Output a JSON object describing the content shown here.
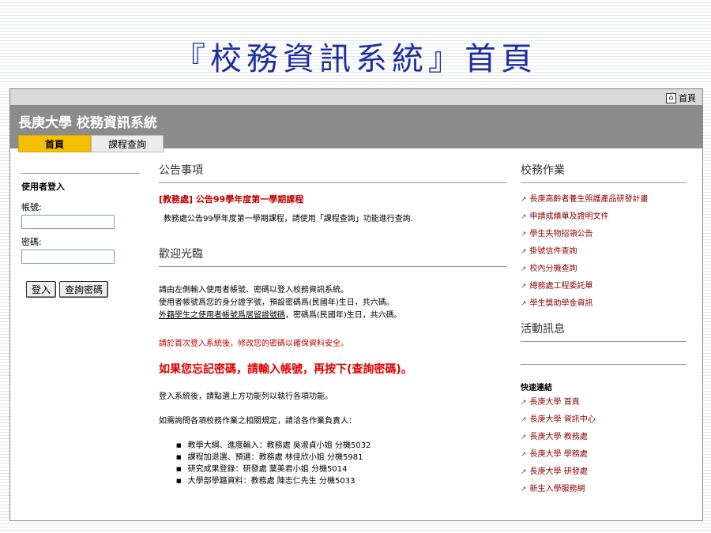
{
  "slide": {
    "title": "『校務資訊系統』首頁"
  },
  "topbar": {
    "home_label": "首頁",
    "home_icon": "home-icon"
  },
  "header": {
    "site_title": "長庚大學 校務資訊系統"
  },
  "tabs": [
    {
      "label": "首頁",
      "active": true
    },
    {
      "label": "課程查詢",
      "active": false
    }
  ],
  "login": {
    "title": "使用者登入",
    "username_label": "帳號:",
    "username_value": "",
    "password_label": "密碼:",
    "password_value": "",
    "login_button": "登入",
    "query_password_button": "查詢密碼"
  },
  "announcements": {
    "title": "公告事項",
    "item_title": "[教務處] 公告99學年度第一學期課程",
    "item_body": "教務處公告99學年度第一學期課程，請使用「課程查詢」功能進行查詢."
  },
  "welcome": {
    "title": "歡迎光臨",
    "line1": "請由左側輸入使用者帳號、密碼以登入校務資訊系統。",
    "line2": "使用者帳號爲您的身分證字號，預設密碼爲(民國年)生日，共六碼。",
    "line3_underlined": "外籍學生之使用者帳號爲居留證號碼",
    "line3_rest": "，密碼爲(民國年)生日，共六碼。",
    "red_note": "請於首次登入系統後，修改您的密碼以確保資料安全。",
    "big_red": "如果您忘記密碼，請輸入帳號，再按下(查詢密碼)。",
    "para1": "登入系統後，請點選上方功能列以執行各項功能。",
    "para2": "如需詢問各項校務作業之相關規定，請洽各作業負責人：",
    "contacts": [
      "教學大綱、進度輸入：教務處 吳淑貞小姐 分機5032",
      "課程加退選、預選：教務處 林佳欣小姐 分機5981",
      "研究成果登錄：研發處 葉美君小姐 分機5014",
      "大學部學籍資料：教務處 陳志仁先生 分機5033"
    ]
  },
  "school_affairs": {
    "title": "校務作業",
    "links": [
      "長庚高齡者養生照護產品研發計畫",
      "申請成績單及證明文件",
      "學生失物招領公告",
      "掛號信件查詢",
      "校內分機查詢",
      "總務處工程委託單",
      "學生獎助學金資訊"
    ]
  },
  "activities": {
    "title": "活動訊息"
  },
  "quick_links": {
    "title": "快速連結",
    "links": [
      "長庚大學 首頁",
      "長庚大學 資訊中心",
      "長庚大學 教務處",
      "長庚大學 學務處",
      "長庚大學 研發處",
      "新生入學服務網"
    ]
  },
  "colors": {
    "title_blue": "#1f2f9e",
    "tab_active": "#f5c000",
    "header_gray": "#8c8c8c",
    "alert_red": "#e00000"
  }
}
